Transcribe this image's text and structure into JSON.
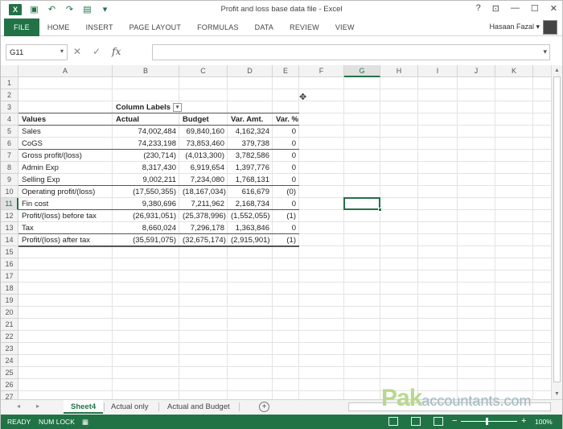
{
  "window": {
    "title": "Profit and loss base data file - Excel",
    "controls": [
      "?",
      "⊡",
      "—",
      "☐",
      "✕"
    ]
  },
  "ribbon": {
    "tabs": [
      "FILE",
      "HOME",
      "INSERT",
      "PAGE LAYOUT",
      "FORMULAS",
      "DATA",
      "REVIEW",
      "VIEW"
    ],
    "user": "Hasaan Fazal"
  },
  "formula_bar": {
    "name_box": "G11",
    "fx_label": "fx",
    "value": ""
  },
  "grid": {
    "columns": [
      "A",
      "B",
      "C",
      "D",
      "E",
      "F",
      "G",
      "H",
      "I",
      "J",
      "K"
    ],
    "selected_column": "G",
    "rows": [
      "1",
      "2",
      "3",
      "4",
      "5",
      "6",
      "7",
      "8",
      "9",
      "10",
      "11",
      "12",
      "13",
      "14",
      "15",
      "16",
      "17",
      "18",
      "19",
      "20",
      "21",
      "22",
      "23",
      "24",
      "25",
      "26",
      "27"
    ],
    "selected_row": "11",
    "selected_cell": "G11"
  },
  "pivot": {
    "column_labels_header": "Column Labels",
    "headers": [
      "Values",
      "Actual",
      "Budget",
      "Var. Amt.",
      "Var. %"
    ],
    "rows": [
      [
        "Sales",
        "74,002,484",
        "69,840,160",
        "4,162,324",
        "0"
      ],
      [
        "CoGS",
        "74,233,198",
        "73,853,460",
        "379,738",
        "0"
      ],
      [
        "Gross profit/(loss)",
        "(230,714)",
        "(4,013,300)",
        "3,782,586",
        "0"
      ],
      [
        "Admin Exp",
        "8,317,430",
        "6,919,654",
        "1,397,776",
        "0"
      ],
      [
        "Selling Exp",
        "9,002,211",
        "7,234,080",
        "1,768,131",
        "0"
      ],
      [
        "Operating profit/(loss)",
        "(17,550,355)",
        "(18,167,034)",
        "616,679",
        "(0)"
      ],
      [
        "Fin cost",
        "9,380,696",
        "7,211,962",
        "2,168,734",
        "0"
      ],
      [
        "Profit/(loss) before tax",
        "(26,931,051)",
        "(25,378,996)",
        "(1,552,055)",
        "(1)"
      ],
      [
        "Tax",
        "8,660,024",
        "7,296,178",
        "1,363,846",
        "0"
      ],
      [
        "Profit/(loss) after tax",
        "(35,591,075)",
        "(32,675,174)",
        "(2,915,901)",
        "(1)"
      ]
    ]
  },
  "sheets": {
    "tabs": [
      "Sheet4",
      "Actual only",
      "Actual and Budget"
    ],
    "active": "Sheet4",
    "add_label": "+"
  },
  "status_bar": {
    "ready": "READY",
    "num_lock": "NUM LOCK",
    "zoom": "100%",
    "zoom_minus": "−",
    "zoom_plus": "+"
  },
  "watermark": {
    "pak": "Pak",
    "accountants": "accountants.com"
  },
  "colors": {
    "accent": "#217346",
    "watermark_green": "#b7d98d",
    "watermark_gray": "#9fb8c2"
  }
}
